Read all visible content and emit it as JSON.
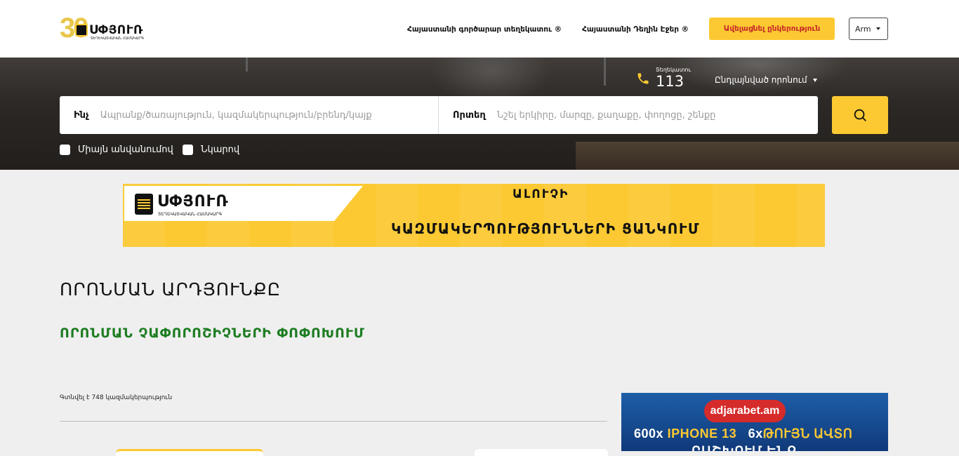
{
  "header": {
    "logo": {
      "number": "30",
      "name": "ՍՓՅՈՒՌ",
      "tagline": "ՏԵՂԵԿԱՏՎԱԿԱՆ ՀԱՄԱԿԱՐԳ"
    },
    "nav": [
      {
        "label": "Հայաստանի գործարար տեղեկատու ®"
      },
      {
        "label": "Հայաստանի Դեղին Էջեր ®"
      }
    ],
    "cta_label": "Ավելացնել ընկերություն",
    "language": "Arm"
  },
  "hero": {
    "phone": {
      "label": "Տեղեկատու",
      "number": "113",
      "icon": "phone-icon"
    },
    "region": "Ընդլայնված որոնում",
    "search": {
      "what_label": "Ինչ",
      "what_placeholder": "Ապրանք/ծառայություն, կազմակերպություն/բրենդ/կայք",
      "where_label": "Որտեղ",
      "where_placeholder": "Նշել երկիրը, մարզը, քաղաքը, փողոցը, շենքը",
      "button_icon": "search-icon"
    },
    "checkboxes": [
      {
        "label": "Միայն անվանումով",
        "checked": false
      },
      {
        "label": "Նկարով",
        "checked": false
      }
    ]
  },
  "banner": {
    "logo_name": "ՍՓՅՈՒՌ",
    "logo_tagline": "ՏԵՂԵԿԱՏՎԱԿԱՆ ՀԱՄԱԿԱՐԳ",
    "top_text": "ԱԼՈՒՉԻ",
    "main_text": "ԿԱԶՄԱԿԵՐՊՈՒԹՅՈՒՆՆԵՐԻ ՑԱՆԿՈՒՄ"
  },
  "results": {
    "title": "ՈՐՈՆՄԱՆ ԱՐԴՅՈՒՆՔԸ",
    "change_criteria": "ՈՐՈՆՄԱՆ ՉԱՓՈՐՈՇԻՉՆԵՐԻ ՓՈՓՈԽՈՒՄ",
    "count_text": "Գտնվել է 748 կազմակերպություն"
  },
  "ad": {
    "brand": "adjarabet.am",
    "line1_a": "600x",
    "line1_b": "IPHONE 13",
    "line1_c": "6x",
    "line1_d": "ԹՈՒՅՆ ԱՎՏՈ",
    "line2": "ԲԱՇԽՈՒՄ ԵՆՔ"
  },
  "colors": {
    "accent": "#fcc932",
    "cta_text": "#c62828",
    "results_green": "#1d7d22",
    "ad_blue": "#1e5ea8",
    "ad_red": "#d62b2b"
  }
}
